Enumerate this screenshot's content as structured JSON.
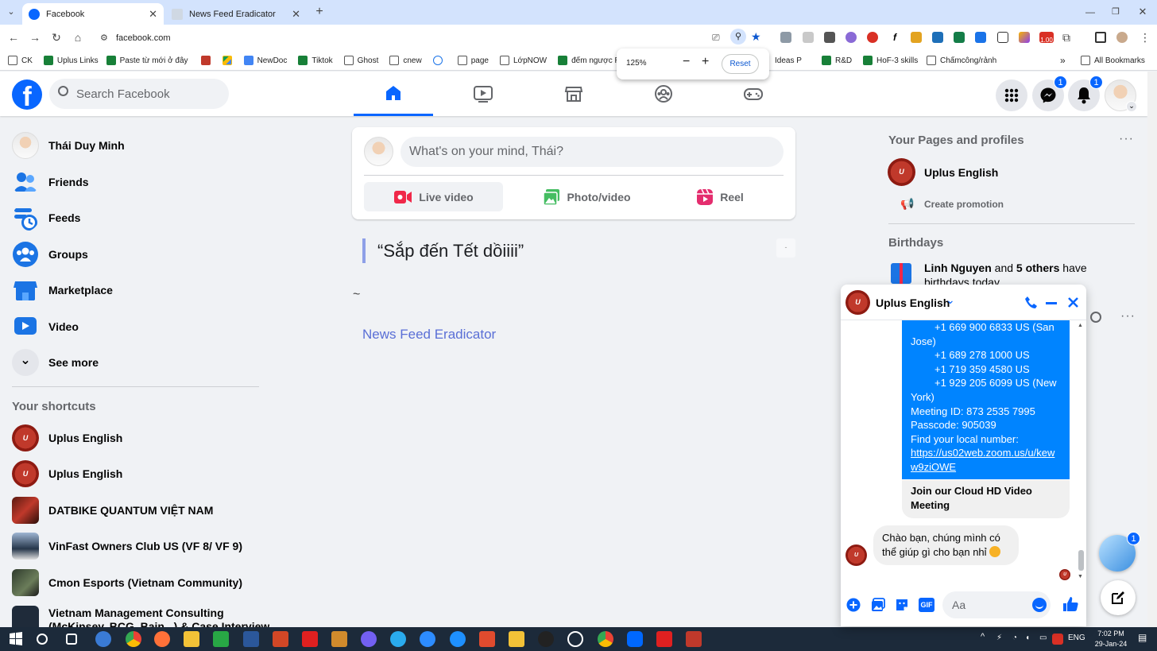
{
  "browser": {
    "tabs": [
      {
        "title": "Facebook",
        "active": true
      },
      {
        "title": "News Feed Eradicator",
        "active": false
      }
    ],
    "url": "facebook.com",
    "zoom": {
      "level": "125%",
      "minus": "−",
      "plus": "+",
      "reset": "Reset"
    },
    "bookmarks": [
      "CK",
      "Uplus Links",
      "Paste từ mới ở đây",
      "NewDoc",
      "Tiktok",
      "Ghost",
      "cnew",
      "page",
      "LớpNOW",
      "đếm ngược R",
      "Ideas P",
      "R&D",
      "HoF-3 skills",
      "Chấmcông/rảnh"
    ],
    "all_bookmarks": "All Bookmarks",
    "more_bookmarks": "»",
    "extension_badge": "1.00"
  },
  "fb": {
    "logo": "f",
    "search_placeholder": "Search Facebook",
    "messenger_badge": "1",
    "notifications_badge": "1",
    "sidebar": {
      "items": [
        {
          "label": "Thái Duy Minh"
        },
        {
          "label": "Friends"
        },
        {
          "label": "Feeds"
        },
        {
          "label": "Groups"
        },
        {
          "label": "Marketplace"
        },
        {
          "label": "Video"
        },
        {
          "label": "See more"
        }
      ],
      "shortcuts_title": "Your shortcuts",
      "shortcuts": [
        {
          "label": "Uplus English"
        },
        {
          "label": "Uplus English"
        },
        {
          "label": "DATBIKE QUANTUM VIỆT NAM"
        },
        {
          "label": "VinFast Owners Club US (VF 8/ VF 9)"
        },
        {
          "label": "Cmon Esports (Vietnam Community)"
        },
        {
          "label": "Vietnam Management Consulting"
        },
        {
          "label": "(McKinsey, BCG, Bain...) & Case Interview"
        }
      ]
    },
    "composer": {
      "placeholder": "What's on your mind, Thái?",
      "live": "Live video",
      "photo": "Photo/video",
      "reel": "Reel"
    },
    "quote": {
      "text": "“Sắp đến Tết dồiiii”",
      "tilde": "~",
      "credit": "News Feed Eradicator",
      "more": "-"
    },
    "right": {
      "pages_title": "Your Pages and profiles",
      "page_name": "Uplus English",
      "create_promotion": "Create promotion",
      "birthdays_title": "Birthdays",
      "birthday_name": "Linh Nguyen",
      "birthday_and": " and ",
      "birthday_others": "5 others",
      "birthday_rest": " have birthdays today.",
      "dots": "···"
    },
    "chat": {
      "name": "Uplus English",
      "blue_lines": [
        {
          "text": "+1 669 900 6833 US (San",
          "indent": true
        },
        {
          "text": "Jose)",
          "indent": false
        },
        {
          "text": "+1 689 278 1000 US",
          "indent": true
        },
        {
          "text": "+1 719 359 4580 US",
          "indent": true
        },
        {
          "text": "+1 929 205 6099 US (New",
          "indent": true
        },
        {
          "text": "York)",
          "indent": false
        },
        {
          "text": "Meeting ID: 873 2535 7995",
          "indent": false
        },
        {
          "text": "Passcode: 905039",
          "indent": false
        },
        {
          "text": "Find your local number:",
          "indent": false
        }
      ],
      "link_line1": "https://us02web.zoom.us/u/kew",
      "link_line2": "w9ziOWE",
      "card_line1": "Join our Cloud HD Video",
      "card_line2": "Meeting",
      "reply_line1": "Chào bạn, chúng mình có",
      "reply_line2": "thể giúp gì cho bạn nhỉ",
      "input_placeholder": "Aa",
      "gif": "GIF"
    },
    "floating_badge": "1"
  },
  "taskbar": {
    "time": "7:02 PM",
    "date": "29-Jan-24",
    "lang": "ENG"
  }
}
